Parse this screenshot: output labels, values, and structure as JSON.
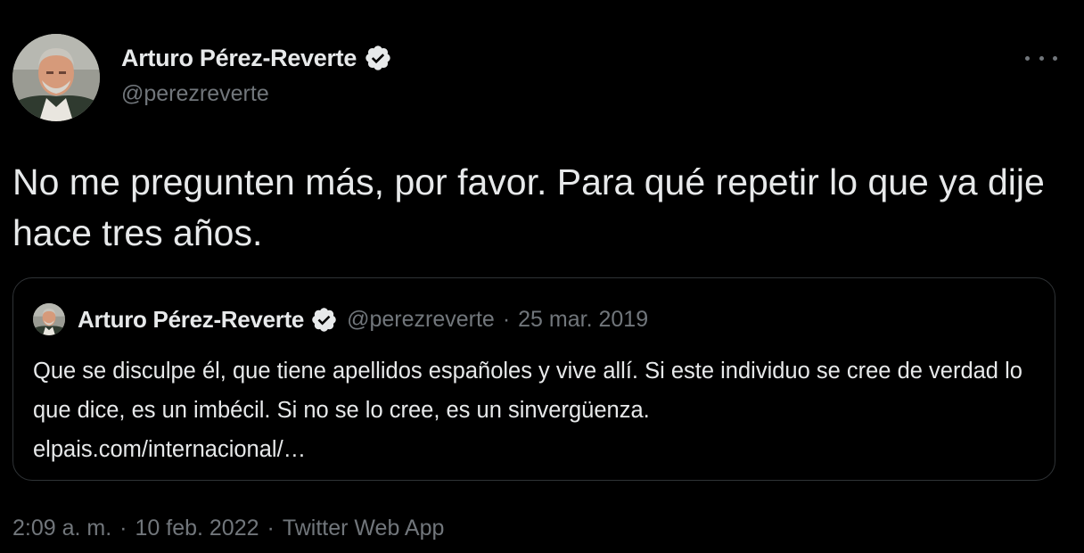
{
  "tweet": {
    "author_name": "Arturo Pérez-Reverte",
    "author_handle": "@perezreverte",
    "text": "No me pregunten más, por favor. Para qué repetir lo que ya dije hace tres años.",
    "time": "2:09 a. m.",
    "date": "10 feb. 2022",
    "separator": "·",
    "source": "Twitter Web App"
  },
  "quoted": {
    "author_name": "Arturo Pérez-Reverte",
    "author_handle": "@perezreverte",
    "separator": "·",
    "date": "25 mar. 2019",
    "text": "Que se disculpe él, que tiene apellidos españoles y vive allí. Si este individuo se cree de verdad lo que dice, es un imbécil. Si no se lo cree, es un sinvergüenza.",
    "link": "elpais.com/internacional/…"
  },
  "icons": {
    "verified": "verified-badge-icon",
    "more": "more-options-icon"
  },
  "colors": {
    "background": "#000000",
    "text": "#e7e9ea",
    "secondary_text": "#71767b",
    "border": "#2f3336"
  }
}
